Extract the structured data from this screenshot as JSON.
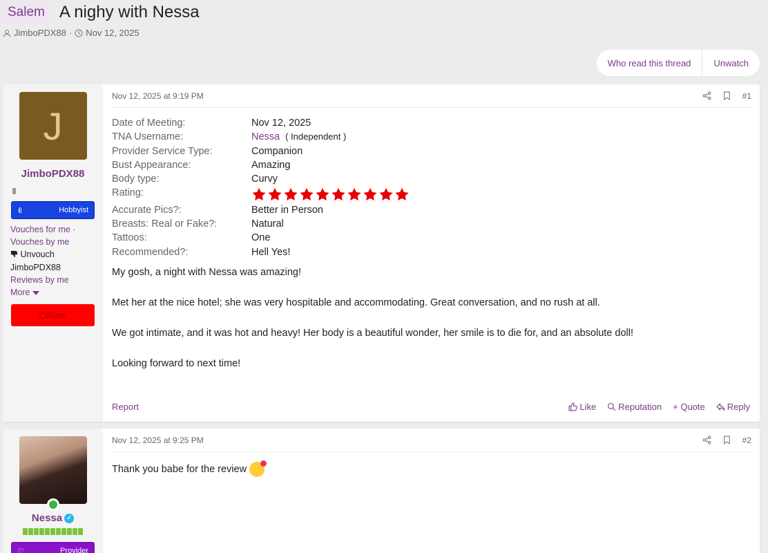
{
  "thread": {
    "prefix": "Salem",
    "title": "A nighy with Nessa",
    "author": "JimboPDX88",
    "date": "Nov 12, 2025",
    "who_read_label": "Who read this thread",
    "unwatch_label": "Unwatch"
  },
  "post1": {
    "user": {
      "avatar_letter": "J",
      "name": "JimboPDX88",
      "badge": "Hobbyist",
      "vouches_for": "Vouches for me ·",
      "vouches_by": "Vouches by me",
      "unvouch": "Unvouch",
      "name_plain": "JimboPDX88",
      "reviews_by": "Reviews by me",
      "more": "More",
      "status": "Offline"
    },
    "timestamp": "Nov 12, 2025 at 9:19 PM",
    "number": "#1",
    "fields": [
      {
        "label": "Date of Meeting:",
        "value": "Nov 12, 2025"
      },
      {
        "label": "TNA Username:",
        "value": "Nessa",
        "sub": "( Independent )"
      },
      {
        "label": "Provider Service Type:",
        "value": "Companion"
      },
      {
        "label": "Bust Appearance:",
        "value": "Amazing"
      },
      {
        "label": "Body type:",
        "value": "Curvy"
      },
      {
        "label": "Rating:",
        "rating": 10
      },
      {
        "label": "Accurate Pics?:",
        "value": "Better in Person"
      },
      {
        "label": "Breasts: Real or Fake?:",
        "value": "Natural"
      },
      {
        "label": "Tattoos:",
        "value": "One"
      },
      {
        "label": "Recommended?:",
        "value": "Hell Yes!"
      }
    ],
    "body": [
      "My gosh, a night with Nessa was amazing!",
      "Met her at the nice hotel; she was very hospitable and accommodating. Great conversation, and no rush at all.",
      "We got intimate, and it was hot and heavy! Her body is a beautiful wonder, her smile is to die for, and an absolute doll!",
      "Looking forward to next time!"
    ],
    "report": "Report",
    "like": "Like",
    "reputation": "Reputation",
    "quote": "+ Quote",
    "reply": "Reply"
  },
  "post2": {
    "user": {
      "name": "Nessa",
      "badge": "Provider"
    },
    "timestamp": "Nov 12, 2025 at 9:25 PM",
    "number": "#2",
    "text": "Thank you babe for the review"
  },
  "colors": {
    "accent": "#7a3b86",
    "hobbyist_badge": "#1743e0",
    "provider_badge": "#8a12c9",
    "offline": "#ff0000",
    "star": "#e60000"
  }
}
